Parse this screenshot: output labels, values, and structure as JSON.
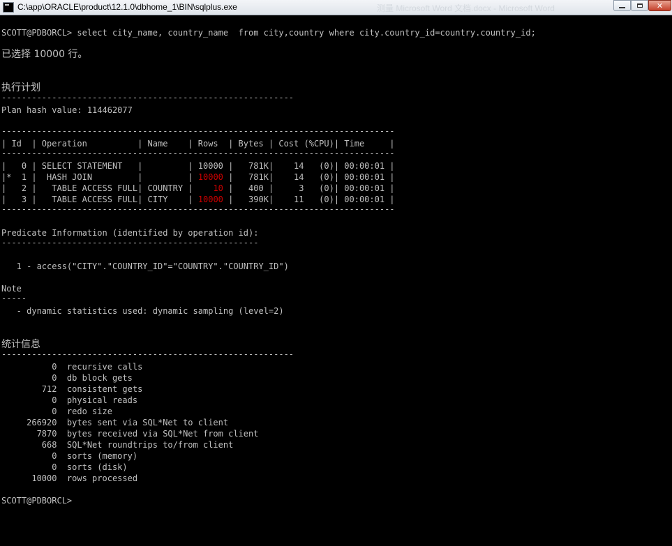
{
  "window": {
    "title": "C:\\app\\ORACLE\\product\\12.1.0\\dbhome_1\\BIN\\sqlplus.exe",
    "ghost_title": "测量 Microsoft Word 文档.docx - Microsoft Word",
    "buttons": {
      "minimize": "minimize",
      "maximize": "maximize",
      "close": "close"
    }
  },
  "console": {
    "prompt_line": "SCOTT@PDBORCL> select city_name, country_name  from city,country where city.country_id=country.country_id;",
    "rows_selected": "已选择 10000 行。",
    "plan_heading": "执行计划",
    "rule_58": "----------------------------------------------------------",
    "plan_hash": "Plan hash value: 114462077",
    "table_rule": "------------------------------------------------------------------------------",
    "table_header": "| Id  | Operation          | Name    | Rows  | Bytes | Cost (%CPU)| Time     |",
    "plan_rows": [
      {
        "prefix": "|   0 | SELECT STATEMENT   |         | ",
        "rows": "10000",
        "highlight": false,
        "suffix": " |   781K|    14   (0)| 00:00:01 |"
      },
      {
        "prefix": "|*  1 |  HASH JOIN         |         | ",
        "rows": "10000",
        "highlight": true,
        "suffix": " |   781K|    14   (0)| 00:00:01 |"
      },
      {
        "prefix": "|   2 |   TABLE ACCESS FULL| COUNTRY | ",
        "rows": "   10",
        "highlight": true,
        "suffix": " |   400 |     3   (0)| 00:00:01 |"
      },
      {
        "prefix": "|   3 |   TABLE ACCESS FULL| CITY    | ",
        "rows": "10000",
        "highlight": true,
        "suffix": " |   390K|    11   (0)| 00:00:01 |"
      }
    ],
    "predicate_heading": "Predicate Information (identified by operation id):",
    "rule_51": "---------------------------------------------------",
    "predicate_line": "   1 - access(\"CITY\".\"COUNTRY_ID\"=\"COUNTRY\".\"COUNTRY_ID\")",
    "note_heading": "Note",
    "rule_5": "-----",
    "note_line": "   - dynamic statistics used: dynamic sampling (level=2)",
    "stats_heading": "统计信息",
    "stats": [
      "          0  recursive calls",
      "          0  db block gets",
      "        712  consistent gets",
      "          0  physical reads",
      "          0  redo size",
      "     266920  bytes sent via SQL*Net to client",
      "       7870  bytes received via SQL*Net from client",
      "        668  SQL*Net roundtrips to/from client",
      "          0  sorts (memory)",
      "          0  sorts (disk)",
      "      10000  rows processed"
    ],
    "final_prompt": "SCOTT@PDBORCL>"
  }
}
